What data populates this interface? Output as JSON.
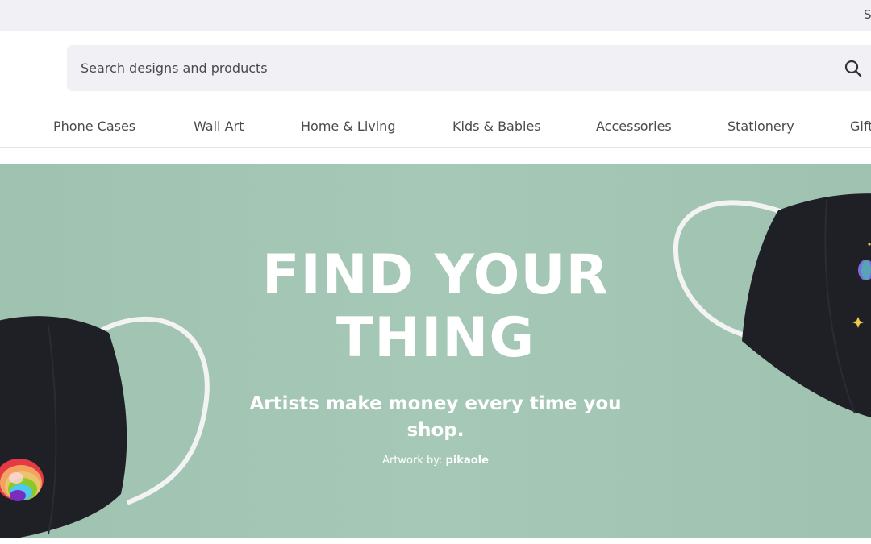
{
  "topbar": {
    "text": "S"
  },
  "search": {
    "placeholder": "Search designs and products"
  },
  "nav": {
    "items": [
      "Phone Cases",
      "Wall Art",
      "Home & Living",
      "Kids & Babies",
      "Accessories",
      "Stationery",
      "Gift"
    ]
  },
  "hero": {
    "title_line1": "FIND YOUR",
    "title_line2": "THING",
    "subtitle": "Artists make money every time you shop.",
    "credit_prefix": "Artwork by: ",
    "credit_artist": "pikaole"
  },
  "colors": {
    "hero_bg": "#a3c6b4",
    "mask": "#1f2026",
    "strap": "#f3f3f3",
    "topbar_bg": "#f1f0f5"
  },
  "icons": [
    "search-icon",
    "face-mask-image"
  ]
}
